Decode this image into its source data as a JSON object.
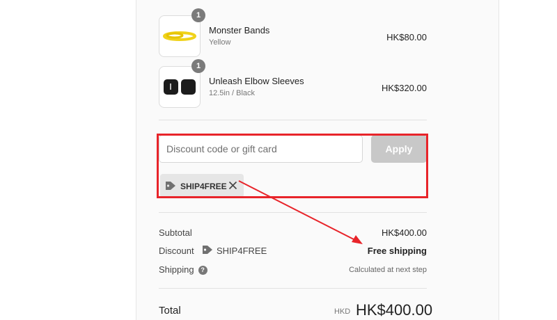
{
  "cart": {
    "items": [
      {
        "name": "Monster Bands",
        "variant": "Yellow",
        "price": "HK$80.00",
        "quantity": "1",
        "image": "yellow-resistance-band"
      },
      {
        "name": "Unleash Elbow Sleeves",
        "variant": "12.5in / Black",
        "price": "HK$320.00",
        "quantity": "1",
        "image": "black-elbow-sleeves"
      }
    ]
  },
  "discount": {
    "placeholder": "Discount code or gift card",
    "apply_label": "Apply",
    "applied_code": "SHIP4FREE",
    "highlight_color": "#e8242a"
  },
  "summary": {
    "subtotal_label": "Subtotal",
    "subtotal_value": "HK$400.00",
    "discount_label": "Discount",
    "discount_code": "SHIP4FREE",
    "discount_value": "Free shipping",
    "shipping_label": "Shipping",
    "shipping_value": "Calculated at next step",
    "total_label": "Total",
    "total_currency": "HKD",
    "total_value": "HK$400.00"
  }
}
